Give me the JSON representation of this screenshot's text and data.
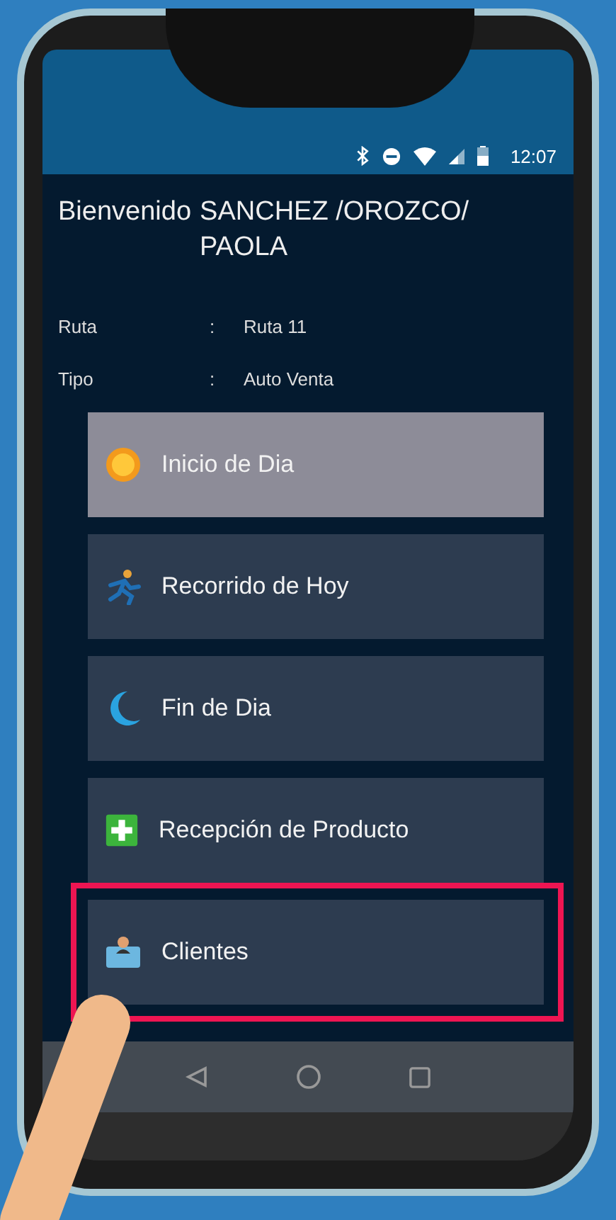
{
  "status_bar": {
    "time": "12:07"
  },
  "header": {
    "greeting": "Bienvenido",
    "name": "SANCHEZ /OROZCO/ PAOLA"
  },
  "info": [
    {
      "label": "Ruta",
      "separator": ":",
      "value": "Ruta 11"
    },
    {
      "label": "Tipo",
      "separator": ":",
      "value": "Auto Venta"
    }
  ],
  "menu": [
    {
      "kind": "sun",
      "label": "Inicio de Dia",
      "selected": true,
      "highlighted": false
    },
    {
      "kind": "runner",
      "label": "Recorrido de Hoy",
      "selected": false,
      "highlighted": false
    },
    {
      "kind": "moon",
      "label": "Fin de Dia",
      "selected": false,
      "highlighted": false
    },
    {
      "kind": "plus",
      "label": "Recepción de Producto",
      "selected": false,
      "highlighted": false
    },
    {
      "kind": "clients",
      "label": "Clientes",
      "selected": false,
      "highlighted": true
    }
  ]
}
